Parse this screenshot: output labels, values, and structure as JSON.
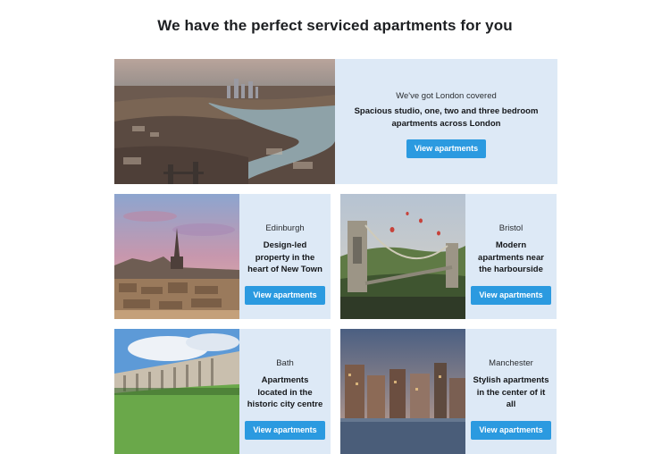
{
  "heading": "We have the perfect serviced apartments for you",
  "cards": [
    {
      "city": "We've got London covered",
      "description": "Spacious studio, one, two and three bedroom apartments across London",
      "button": "View apartments"
    },
    {
      "city": "Edinburgh",
      "description": "Design-led property in the heart of New Town",
      "button": "View apartments"
    },
    {
      "city": "Bristol",
      "description": "Modern apartments near the harbourside",
      "button": "View apartments"
    },
    {
      "city": "Bath",
      "description": "Apartments located in the historic city centre",
      "button": "View apartments"
    },
    {
      "city": "Manchester",
      "description": "Stylish apartments in the center of it all",
      "button": "View apartments"
    }
  ],
  "colors": {
    "card_background": "#dde9f6",
    "button": "#2b9ae0"
  }
}
